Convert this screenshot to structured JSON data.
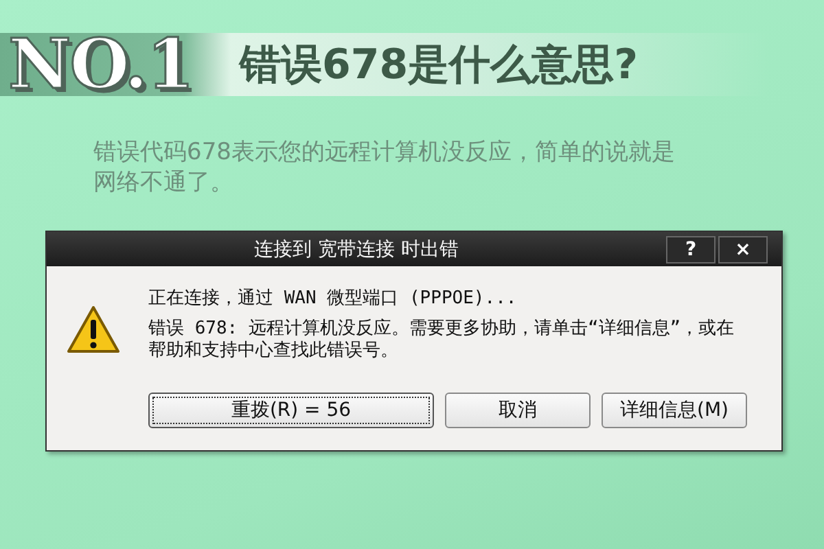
{
  "badge": "NO.1",
  "heading": "错误678是什么意思?",
  "description": "错误代码678表示您的远程计算机没反应，简单的说就是网络不通了。",
  "dialog": {
    "title": "连接到 宽带连接 时出错",
    "title_buttons": [
      "?",
      "×"
    ],
    "status": "正在连接，通过 WAN 微型端口 (PPPOE)...",
    "message": "错误 678: 远程计算机没反应。需要更多协助，请单击“详细信息”，或在帮助和支持中心查找此错误号。",
    "buttons": [
      {
        "label": "重拨(R) = 56",
        "focused": true
      },
      {
        "label": "取消",
        "focused": false
      },
      {
        "label": "详细信息(M)",
        "focused": false
      }
    ]
  }
}
